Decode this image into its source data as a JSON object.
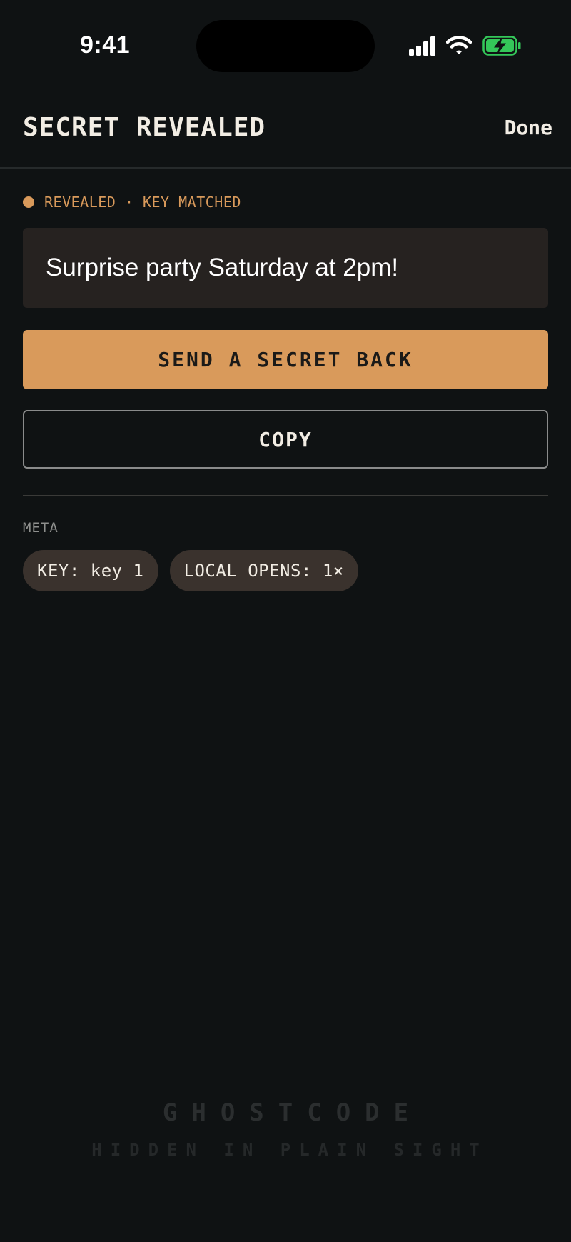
{
  "status_bar": {
    "time": "9:41",
    "icons": [
      "signal-icon",
      "wifi-icon",
      "battery-charging-icon"
    ],
    "battery_color": "#34c759"
  },
  "header": {
    "title": "SECRET REVEALED",
    "done_label": "Done"
  },
  "status": {
    "text": "REVEALED · KEY MATCHED",
    "accent_color": "#d99a5b"
  },
  "message": {
    "text": "Surprise party Saturday at 2pm!"
  },
  "actions": {
    "send_back_label": "SEND A SECRET BACK",
    "copy_label": "COPY"
  },
  "meta": {
    "label": "META",
    "chips": [
      "KEY: key 1",
      "LOCAL OPENS: 1×"
    ]
  },
  "footer": {
    "brand": "GHOSTCODE",
    "tagline": "HIDDEN IN PLAIN SIGHT"
  }
}
